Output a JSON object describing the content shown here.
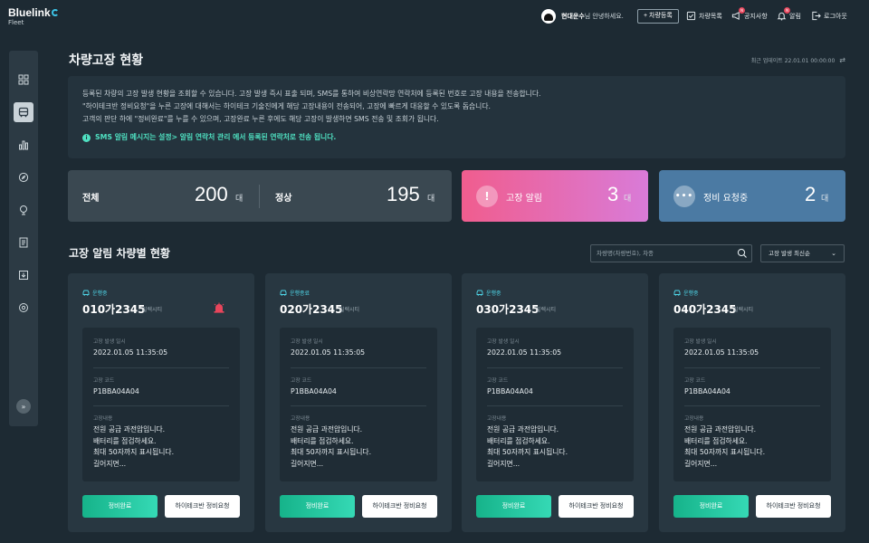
{
  "header": {
    "logo": "Bluelink",
    "logo_sub": "Fleet",
    "user_name": "현대운수",
    "user_greeting": "님 안녕하세요.",
    "register_label": "+ 차량등록",
    "menu": [
      {
        "label": "차량목록",
        "icon": "car-list-icon"
      },
      {
        "label": "공지사항",
        "icon": "megaphone-icon",
        "badge": "N"
      },
      {
        "label": "알림",
        "icon": "bell-icon",
        "badge": "N"
      },
      {
        "label": "로그아웃",
        "icon": "logout-icon"
      }
    ]
  },
  "sidebar": {
    "items": [
      "dashboard-icon",
      "bus-icon",
      "chart-icon",
      "compass-icon",
      "location-icon",
      "document-icon",
      "download-icon",
      "settings-icon"
    ],
    "active_index": 1
  },
  "page": {
    "title": "차량고장 현황",
    "last_update": "최근 업데이트 22.01.01 00:00:00"
  },
  "info": {
    "lines": [
      "등록된 차량의 고장 발생 현황을 조회할 수 있습니다. 고장 발생 즉시 표출 되며, SMS를 통하여 비상연락망 연락처에 등록된 번호로 고장 내용을 전송합니다.",
      "\"하이테크반 정비요청\"을 누른 고장에 대해서는 하이테크 기술진에게 해당 고장내용이 전송되어, 고장에 빠르게 대응할 수 있도록 돕습니다.",
      "고객의 판단 하에 \"정비완료\"를 누를 수 있으며, 고장완료 누른 후에도 해당 고장이 발생하면 SMS 전송 및 조회가 됩니다."
    ],
    "note": "SMS 알림 메시지는 설정> 알림 연락처 관리 에서 등록된 연락처로 전송 됩니다."
  },
  "stats": {
    "total_label": "전체",
    "total_value": "200",
    "normal_label": "정상",
    "normal_value": "195",
    "unit": "대",
    "alert_label": "고장 알림",
    "alert_value": "3",
    "request_label": "정비 요청중",
    "request_value": "2"
  },
  "section": {
    "title": "고장 알림 차량별 현황",
    "search_placeholder": "차량명(차량번호), 차종",
    "sort_label": "고장 발생 최신순"
  },
  "card_labels": {
    "time": "고장 발생 일시",
    "code": "고장 코드",
    "content": "고장내용",
    "done_button": "정비완료",
    "request_button": "하이테크반 정비요청"
  },
  "vehicles": [
    {
      "status": "운행중",
      "plate": "010가2345",
      "model": "일렉시티",
      "time": "2022.01.05 11:35:05",
      "code": "P1BBA04A04",
      "content": [
        "전원 공급 과전압입니다.",
        "배터리를 점검하세요.",
        "최대 50자까지 표시됩니다.",
        "길어지면..."
      ],
      "alert": true
    },
    {
      "status": "운행종료",
      "plate": "020가2345",
      "model": "일렉시티",
      "time": "2022.01.05 11:35:05",
      "code": "P1BBA04A04",
      "content": [
        "전원 공급 과전압입니다.",
        "배터리를 점검하세요.",
        "최대 50자까지 표시됩니다.",
        "길어지면..."
      ],
      "alert": false
    },
    {
      "status": "운행중",
      "plate": "030가2345",
      "model": "일렉시티",
      "time": "2022.01.05 11:35:05",
      "code": "P1BBA04A04",
      "content": [
        "전원 공급 과전압입니다.",
        "배터리를 점검하세요.",
        "최대 50자까지 표시됩니다.",
        "길어지면..."
      ],
      "alert": false
    },
    {
      "status": "운행중",
      "plate": "040가2345",
      "model": "일렉시티",
      "time": "2022.01.05 11:35:05",
      "code": "P1BBA04A04",
      "content": [
        "전원 공급 과전압입니다.",
        "배터리를 점검하세요.",
        "최대 50자까지 표시됩니다.",
        "길어지면..."
      ],
      "alert": false
    }
  ],
  "colors": {
    "background": "#1d2a33",
    "accent_teal": "#4fe0c1",
    "status_cyan": "#4fd6e8",
    "alert_red": "#e8455b"
  }
}
